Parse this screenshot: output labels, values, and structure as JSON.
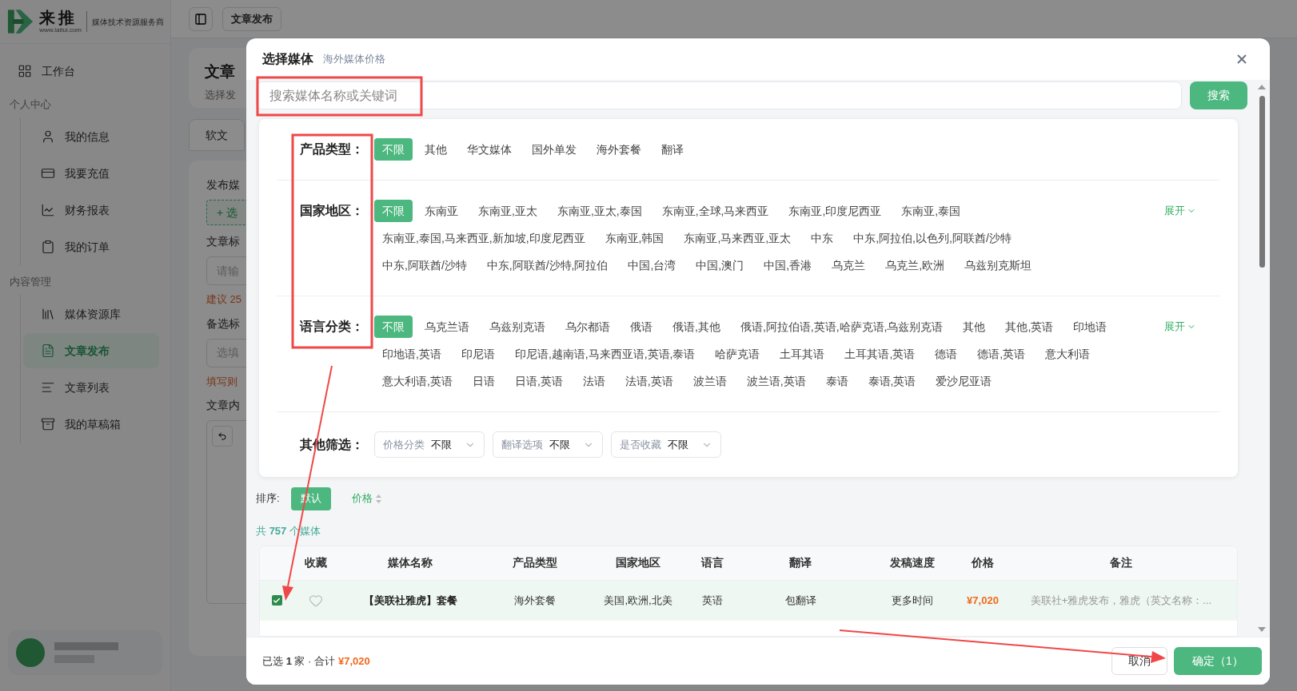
{
  "sidebar": {
    "logo": {
      "name": "来推",
      "url": "www.laitui.com",
      "tagline": "媒体技术资源服务商"
    },
    "top_item": {
      "label": "工作台",
      "selected": false
    },
    "sections": [
      {
        "title": "个人中心",
        "items": [
          {
            "label": "我的信息",
            "selected": false
          },
          {
            "label": "我要充值",
            "selected": false
          },
          {
            "label": "财务报表",
            "selected": false
          },
          {
            "label": "我的订单",
            "selected": false
          }
        ]
      },
      {
        "title": "内容管理",
        "items": [
          {
            "label": "媒体资源库",
            "selected": false
          },
          {
            "label": "文章发布",
            "selected": true
          },
          {
            "label": "文章列表",
            "selected": false
          },
          {
            "label": "我的草稿箱",
            "selected": false
          }
        ]
      }
    ]
  },
  "topbar": {
    "tab": "文章发布"
  },
  "page": {
    "title": "文章",
    "subtitle": "选择发",
    "tabs": [
      {
        "label": "软文",
        "selected": true
      }
    ],
    "form": [
      {
        "label": "发布媒",
        "kind": "picker",
        "button": "+ 选"
      },
      {
        "label": "文章标",
        "kind": "input",
        "placeholder": "请输",
        "hint": "建议 25"
      },
      {
        "label": "备选标",
        "kind": "input",
        "placeholder": "选填",
        "hint": "填写则"
      },
      {
        "label": "文章内",
        "kind": "editor"
      }
    ]
  },
  "modal": {
    "title": "选择媒体",
    "subtitle": "海外媒体价格",
    "search": {
      "placeholder": "搜索媒体名称或关键词",
      "button": "搜索"
    },
    "filters": [
      {
        "label": "产品类型：",
        "kind": "options",
        "options": [
          {
            "label": "不限",
            "selected": true
          },
          {
            "label": "其他",
            "selected": false
          },
          {
            "label": "华文媒体",
            "selected": false
          },
          {
            "label": "国外单发",
            "selected": false
          },
          {
            "label": "海外套餐",
            "selected": false
          },
          {
            "label": "翻译",
            "selected": false
          }
        ]
      },
      {
        "label": "国家地区：",
        "kind": "options",
        "expand": "展开",
        "options": [
          {
            "label": "不限",
            "selected": true
          },
          {
            "label": "东南亚",
            "selected": false
          },
          {
            "label": "东南亚,亚太",
            "selected": false
          },
          {
            "label": "东南亚,亚太,泰国",
            "selected": false
          },
          {
            "label": "东南亚,全球,马来西亚",
            "selected": false
          },
          {
            "label": "东南亚,印度尼西亚",
            "selected": false
          },
          {
            "label": "东南亚,泰国",
            "selected": false
          },
          {
            "label": "东南亚,泰国,马来西亚,新加坡,印度尼西亚",
            "selected": false
          },
          {
            "label": "东南亚,韩国",
            "selected": false
          },
          {
            "label": "东南亚,马来西亚,亚太",
            "selected": false
          },
          {
            "label": "中东",
            "selected": false
          },
          {
            "label": "中东,阿拉伯,以色列,阿联酋/沙特",
            "selected": false
          },
          {
            "label": "中东,阿联酋/沙特",
            "selected": false
          },
          {
            "label": "中东,阿联酋/沙特,阿拉伯",
            "selected": false
          },
          {
            "label": "中国,台湾",
            "selected": false
          },
          {
            "label": "中国,澳门",
            "selected": false
          },
          {
            "label": "中国,香港",
            "selected": false
          },
          {
            "label": "乌克兰",
            "selected": false
          },
          {
            "label": "乌克兰,欧洲",
            "selected": false
          },
          {
            "label": "乌兹别克斯坦",
            "selected": false
          }
        ]
      },
      {
        "label": "语言分类：",
        "kind": "options",
        "expand": "展开",
        "options": [
          {
            "label": "不限",
            "selected": true
          },
          {
            "label": "乌克兰语",
            "selected": false
          },
          {
            "label": "乌兹别克语",
            "selected": false
          },
          {
            "label": "乌尔都语",
            "selected": false
          },
          {
            "label": "俄语",
            "selected": false
          },
          {
            "label": "俄语,其他",
            "selected": false
          },
          {
            "label": "俄语,阿拉伯语,英语,哈萨克语,乌兹别克语",
            "selected": false
          },
          {
            "label": "其他",
            "selected": false
          },
          {
            "label": "其他,英语",
            "selected": false
          },
          {
            "label": "印地语",
            "selected": false
          },
          {
            "label": "印地语,英语",
            "selected": false
          },
          {
            "label": "印尼语",
            "selected": false
          },
          {
            "label": "印尼语,越南语,马来西亚语,英语,泰语",
            "selected": false
          },
          {
            "label": "哈萨克语",
            "selected": false
          },
          {
            "label": "土耳其语",
            "selected": false
          },
          {
            "label": "土耳其语,英语",
            "selected": false
          },
          {
            "label": "德语",
            "selected": false
          },
          {
            "label": "德语,英语",
            "selected": false
          },
          {
            "label": "意大利语",
            "selected": false
          },
          {
            "label": "意大利语,英语",
            "selected": false
          },
          {
            "label": "日语",
            "selected": false
          },
          {
            "label": "日语,英语",
            "selected": false
          },
          {
            "label": "法语",
            "selected": false
          },
          {
            "label": "法语,英语",
            "selected": false
          },
          {
            "label": "波兰语",
            "selected": false
          },
          {
            "label": "波兰语,英语",
            "selected": false
          },
          {
            "label": "泰语",
            "selected": false
          },
          {
            "label": "泰语,英语",
            "selected": false
          },
          {
            "label": "爱沙尼亚语",
            "selected": false
          }
        ]
      },
      {
        "label": "其他筛选：",
        "kind": "selects",
        "selects": [
          {
            "label": "价格分类",
            "value": "不限"
          },
          {
            "label": "翻译选项",
            "value": "不限"
          },
          {
            "label": "是否收藏",
            "value": "不限"
          }
        ]
      }
    ],
    "sort": {
      "label": "排序:",
      "options": [
        {
          "label": "默认",
          "selected": true
        },
        {
          "label": "价格",
          "selected": false
        }
      ]
    },
    "count": "共 **757** 个媒体",
    "table": {
      "favorite_column": "收藏",
      "columns": [
        "媒体名称",
        "产品类型",
        "国家地区",
        "语言",
        "翻译",
        "发稿速度",
        "价格",
        "备注"
      ],
      "rows": [
        {
          "selected": true,
          "favorite": false,
          "cells": [
            "【美联社雅虎】套餐",
            "海外套餐",
            "美国,欧洲,北美",
            "英语",
            "包翻译",
            "更多时间",
            "¥7,020",
            "美联社+雅虎发布，雅虎（英文名称：..."
          ]
        }
      ]
    },
    "footer": {
      "summary": "已选 **1** 家 · 合计",
      "total": "¥7,020",
      "buttons": [
        {
          "label": "取消",
          "kind": "secondary"
        },
        {
          "label": "确定（1）",
          "kind": "primary"
        }
      ]
    }
  }
}
